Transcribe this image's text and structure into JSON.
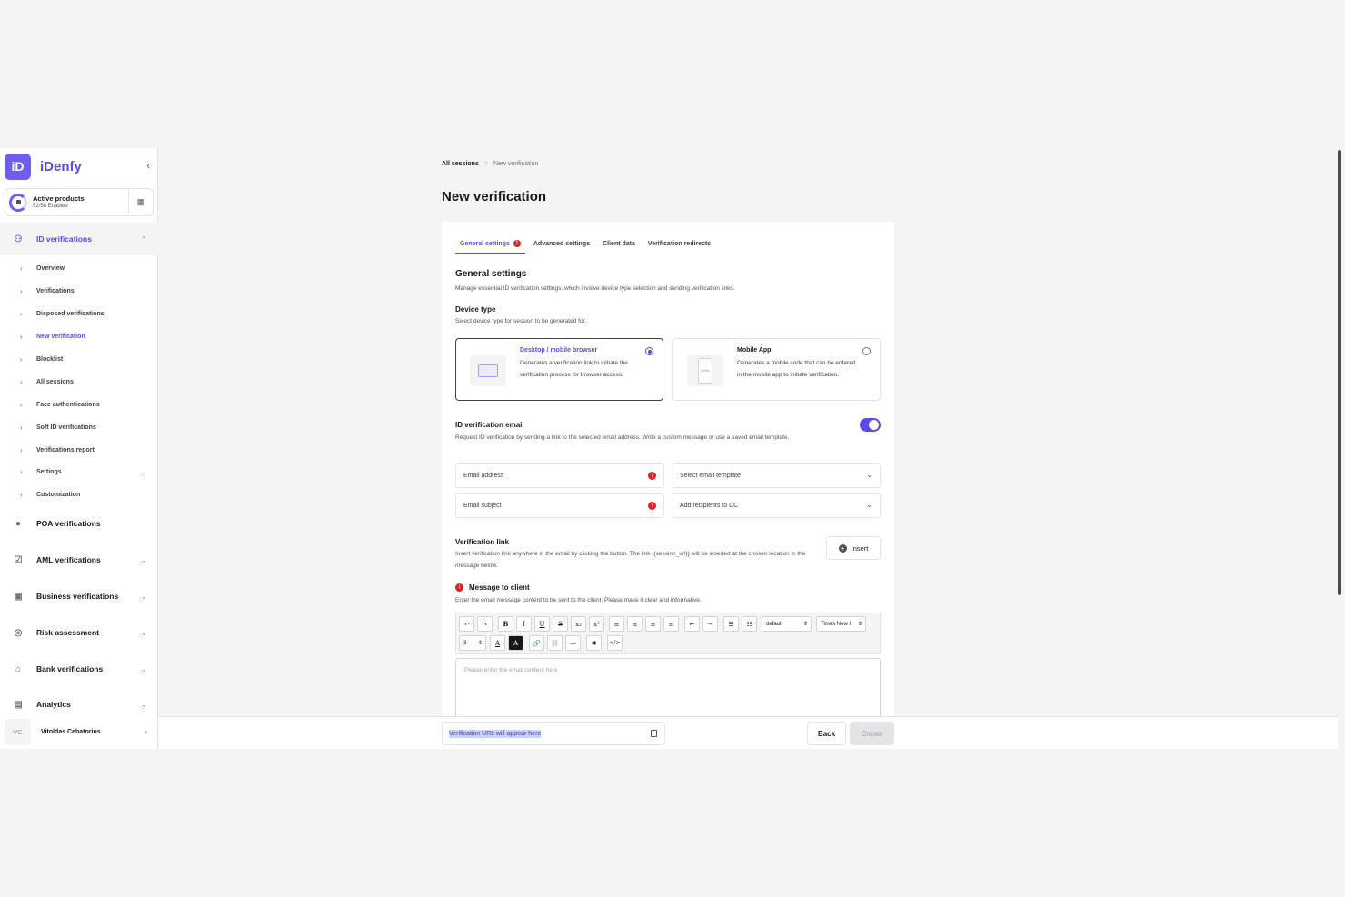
{
  "brand": {
    "logo_mark": "iD",
    "name": "iDenfy"
  },
  "products": {
    "title": "Active products",
    "subtitle": "52/58 Enabled"
  },
  "sidebar": {
    "sections": [
      {
        "label": "ID verifications",
        "icon": "user-check-icon"
      },
      {
        "label": "POA verifications",
        "icon": "location-pin-icon"
      },
      {
        "label": "AML verifications",
        "icon": "shield-check-icon"
      },
      {
        "label": "Business verifications",
        "icon": "briefcase-icon"
      },
      {
        "label": "Risk assessment",
        "icon": "target-icon"
      },
      {
        "label": "Bank verifications",
        "icon": "bank-icon"
      },
      {
        "label": "Analytics",
        "icon": "chart-icon"
      }
    ],
    "sub_items": [
      {
        "label": "Overview"
      },
      {
        "label": "Verifications"
      },
      {
        "label": "Disposed verifications"
      },
      {
        "label": "New verification"
      },
      {
        "label": "Blocklist"
      },
      {
        "label": "All sessions"
      },
      {
        "label": "Face authentications"
      },
      {
        "label": "Soft ID verifications"
      },
      {
        "label": "Verifications report"
      },
      {
        "label": "Settings"
      },
      {
        "label": "Customization"
      }
    ],
    "user": {
      "initials": "VC",
      "name": "Vitoldas Cebatorius"
    }
  },
  "breadcrumb": {
    "root": "All sessions",
    "separator": ">",
    "current": "New verification"
  },
  "page_title": "New verification",
  "tabs": [
    {
      "label": "General settings"
    },
    {
      "label": "Advanced settings"
    },
    {
      "label": "Client data"
    },
    {
      "label": "Verification redirects"
    }
  ],
  "general": {
    "title": "General settings",
    "desc": "Manage essential ID verification settings, which involve device type selection and sending verification links."
  },
  "device_type": {
    "title": "Device type",
    "desc": "Select device type for session to be generated for.",
    "options": [
      {
        "title": "Desktop / mobile browser",
        "text": "Generates a verification link to initiate the verification process for browser access.",
        "selected": true
      },
      {
        "title": "Mobile App",
        "text": "Generates a mobile code that can be entered in the mobile app to initiate verification.",
        "phone_label": "iDenfy",
        "selected": false
      }
    ]
  },
  "email": {
    "title": "ID verification email",
    "desc": "Request ID verification by sending a link to the selected email address. Write a custom message or use a saved email template.",
    "toggle_on": true,
    "email_address": "Email address",
    "email_template": "Select email template",
    "email_subject": "Email subject",
    "cc": "Add recipients to CC"
  },
  "link": {
    "title": "Verification link",
    "desc": "Insert verification link anywhere in the email by clicking the button. The link {{session_url}} will be inserted at the chosen location in the message below.",
    "insert_label": "Insert"
  },
  "message": {
    "title": "Message to client",
    "desc": "Enter the email message content to be sent to the client. Please make it clear and informative.",
    "placeholder": "Please enter the email content here"
  },
  "toolbar": {
    "row1": [
      "↶",
      "↷",
      "B",
      "I",
      "U",
      "S",
      "x₂",
      "x²",
      "≡",
      "≡",
      "≡",
      "≡",
      "⇤",
      "⇥",
      "☰",
      "☷"
    ],
    "format_select": "default",
    "font_select": "Times New I",
    "size_select": "3",
    "row2": [
      "A",
      "A",
      "🔗",
      "⛓",
      "—",
      "✖",
      "</>"
    ]
  },
  "footer": {
    "url_placeholder": "Verification URL will appear here",
    "back": "Back",
    "create": "Create"
  }
}
